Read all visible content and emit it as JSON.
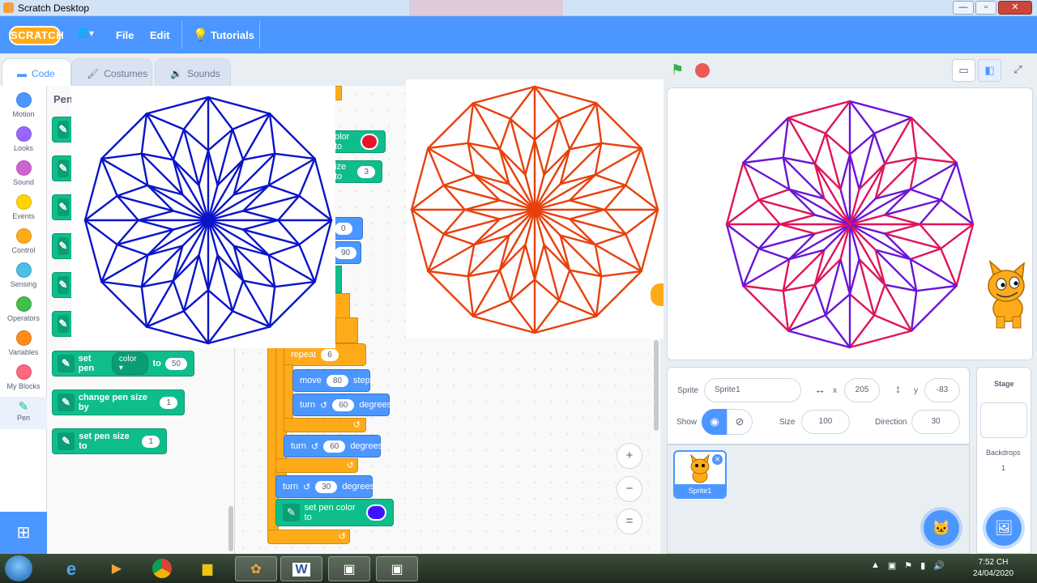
{
  "window": {
    "title": "Scratch Desktop",
    "buttons": [
      "—",
      "▫",
      "✕"
    ]
  },
  "menubar": {
    "logo": "SCRATCH",
    "items": [
      "File",
      "Edit",
      "Tutorials"
    ]
  },
  "tabs": [
    "Code",
    "Costumes",
    "Sounds"
  ],
  "categories": [
    {
      "label": "Motion",
      "color": "#4c97ff"
    },
    {
      "label": "Looks",
      "color": "#9966ff"
    },
    {
      "label": "Sound",
      "color": "#cf63cf"
    },
    {
      "label": "Events",
      "color": "#ffd500"
    },
    {
      "label": "Control",
      "color": "#ffab19"
    },
    {
      "label": "Sensing",
      "color": "#4cbfe6"
    },
    {
      "label": "Operators",
      "color": "#40bf4a"
    },
    {
      "label": "Variables",
      "color": "#ff8c1a"
    },
    {
      "label": "My Blocks",
      "color": "#ff6680"
    },
    {
      "label": "Pen",
      "color": "#0fbd8c"
    }
  ],
  "palette": {
    "heading": "Pen",
    "set_pen": {
      "label": "set pen",
      "dropdown": "color ▾",
      "to": "to",
      "value": "50"
    },
    "change_size": {
      "label": "change pen size by",
      "value": "1"
    },
    "set_size": {
      "label": "set pen size to",
      "value": "1"
    }
  },
  "script": {
    "partial_color": "olor to",
    "partial_size": "ize to",
    "partial_size_value": "3",
    "partial_x": "0",
    "partial_dir": "90",
    "repeat_label": "repeat",
    "repeat_value": "6",
    "move_label": "move",
    "move_value": "80",
    "move_suffix": "steps",
    "turn_label": "turn",
    "turn_suffix": "degrees",
    "turn1_value": "60",
    "turn2_value": "60",
    "turn3_value": "30",
    "set_color_label": "set pen color to",
    "color_red": "#e8132c",
    "color_blue": "#3d13ff"
  },
  "zoom": [
    "+",
    "−",
    "="
  ],
  "stage_controls": {
    "flag": "⚑"
  },
  "sprite_info": {
    "sprite_label": "Sprite",
    "sprite_name": "Sprite1",
    "x_label": "x",
    "x_value": "205",
    "y_label": "y",
    "y_value": "-83",
    "show_label": "Show",
    "size_label": "Size",
    "size_value": "100",
    "direction_label": "Direction",
    "direction_value": "30"
  },
  "sprites": [
    {
      "name": "Sprite1"
    }
  ],
  "stage_panel": {
    "title": "Stage",
    "backdrops_label": "Backdrops",
    "backdrops_count": "1"
  },
  "taskbar": {
    "time": "7:52 CH",
    "date": "24/04/2020"
  },
  "colors": {
    "blue_pattern": "#0a14c8",
    "orange_pattern": "#e8400c",
    "stage_outer": "#6a14d8",
    "stage_inner": "#e0145a"
  }
}
